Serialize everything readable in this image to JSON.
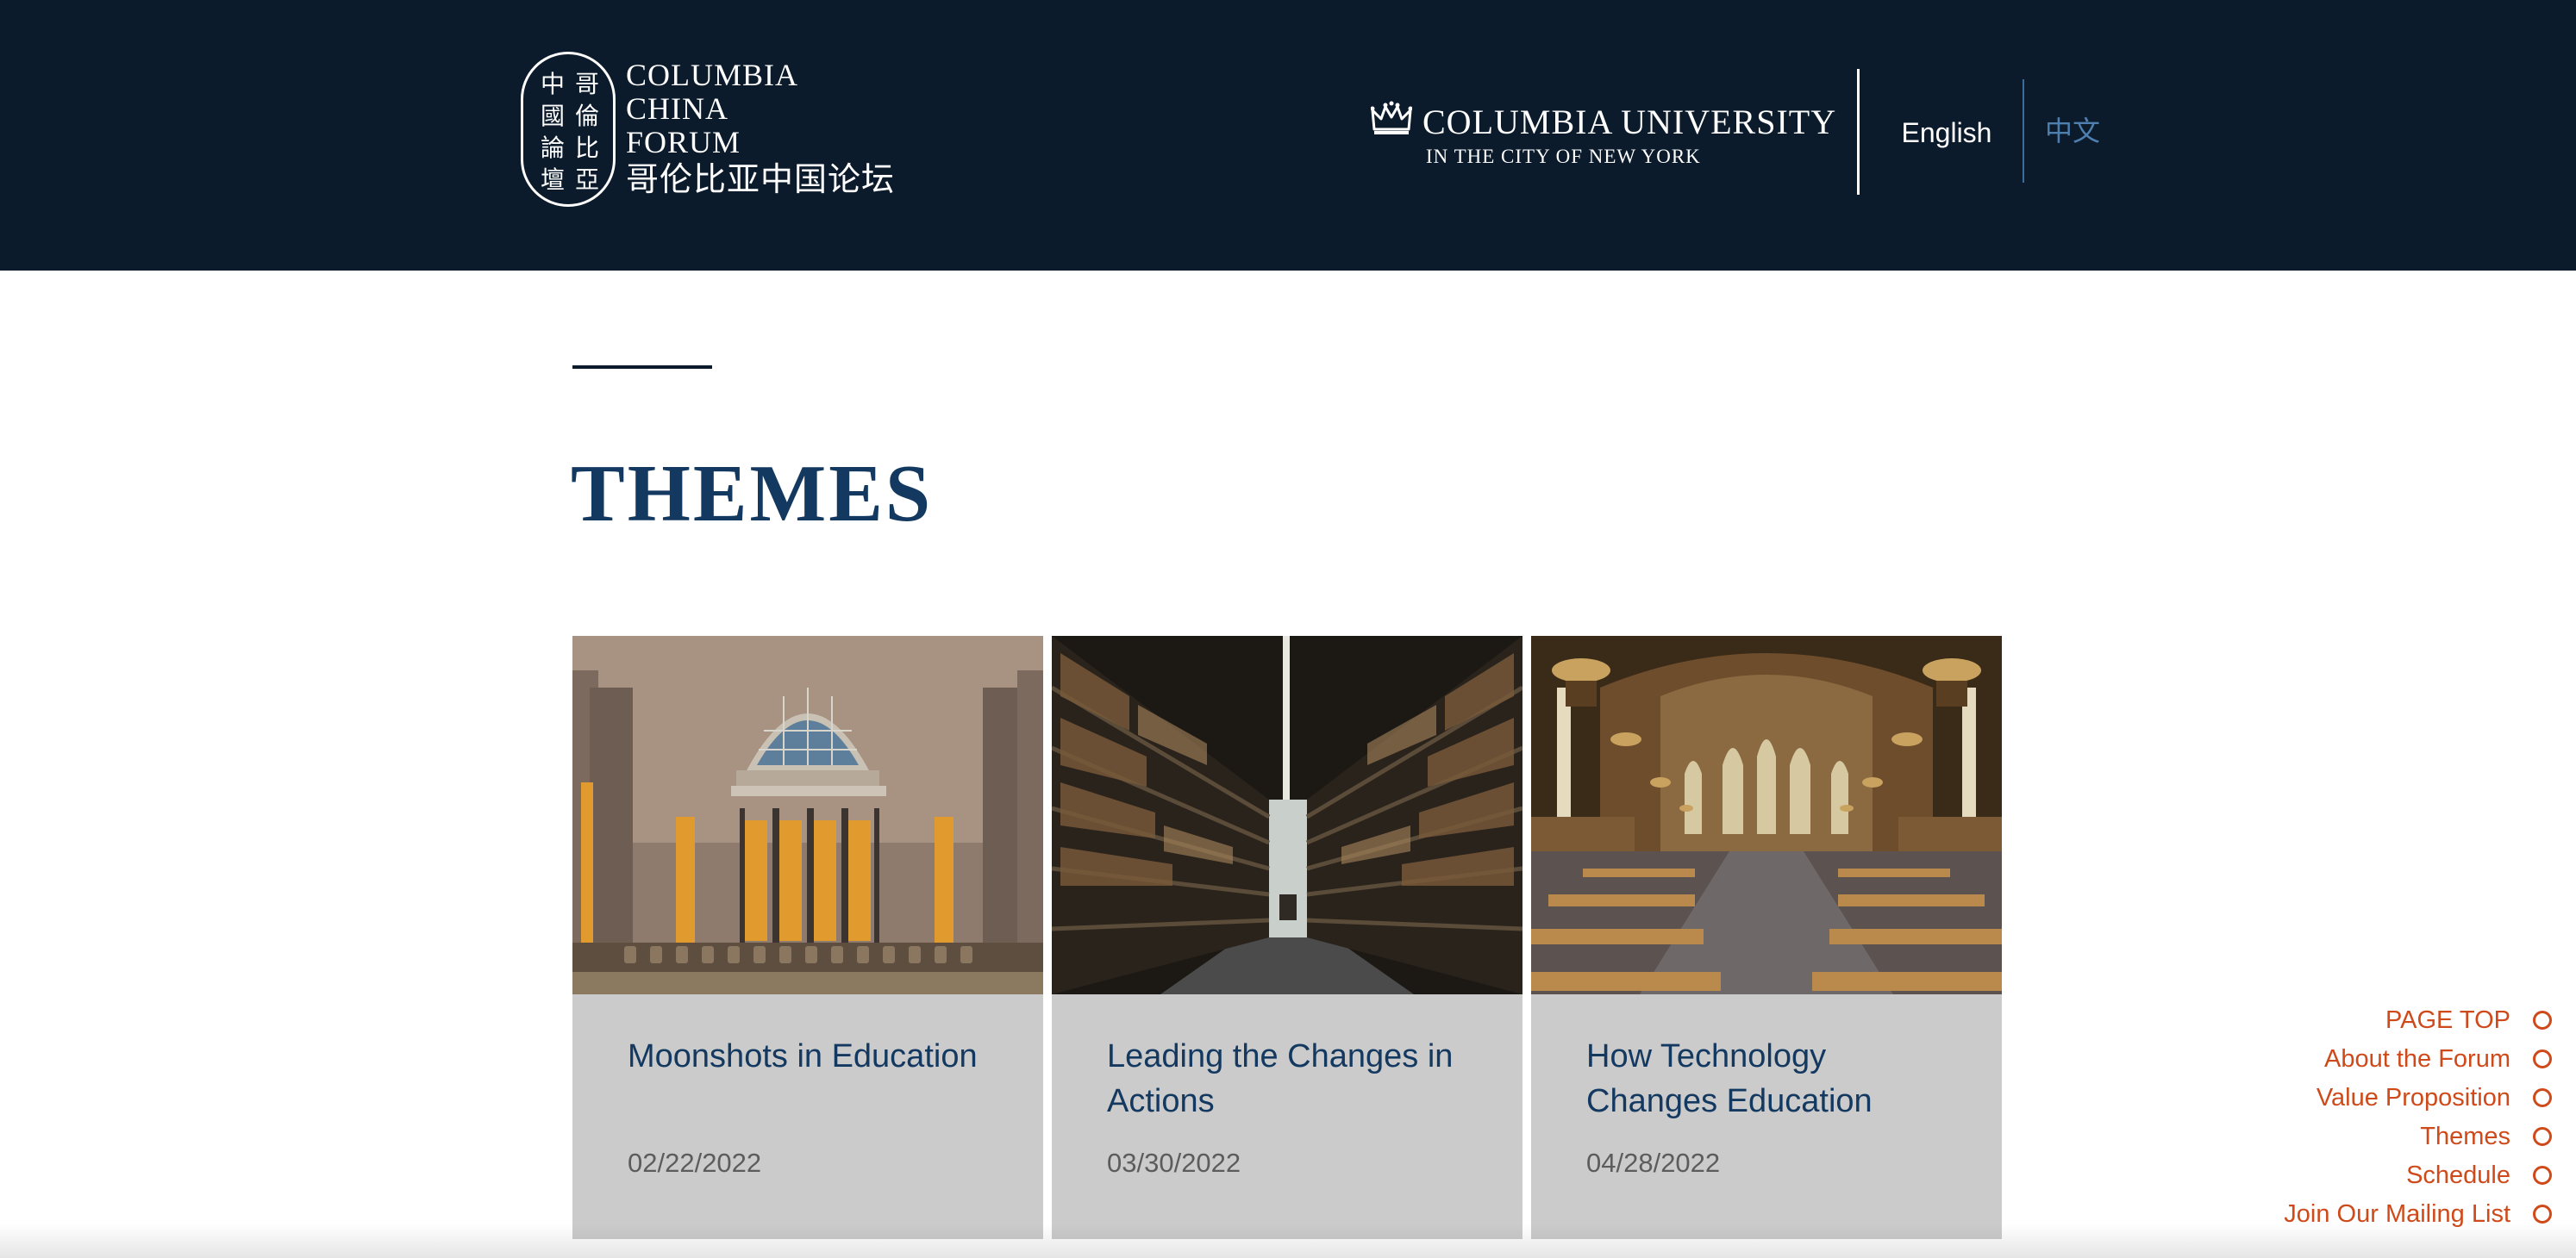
{
  "header": {
    "forum_logo": {
      "seal_chars": [
        "哥",
        "倫",
        "比",
        "亞",
        "中",
        "國",
        "論",
        "壇"
      ],
      "name_lines": [
        "COLUMBIA",
        "CHINA",
        "FORUM"
      ],
      "name_cn": "哥伦比亚中国论坛"
    },
    "university_logo": {
      "name": "COLUMBIA UNIVERSITY",
      "subtitle": "IN THE CITY OF NEW YORK",
      "icon": "crown-icon"
    },
    "language": {
      "english_label": "English",
      "chinese_label": "中文",
      "selected": "English"
    }
  },
  "section": {
    "title": "THEMES"
  },
  "themes": [
    {
      "title": "Moonshots in Education",
      "date": "02/22/2022",
      "image": "library-hall-photo"
    },
    {
      "title": "Leading the Changes in Actions",
      "date": "03/30/2022",
      "image": "library-stacks-photo"
    },
    {
      "title": "How Technology Changes Education",
      "date": "04/28/2022",
      "image": "reading-room-photo"
    }
  ],
  "side_nav": {
    "items": [
      {
        "label": "PAGE TOP"
      },
      {
        "label": "About the Forum"
      },
      {
        "label": "Value Proposition"
      },
      {
        "label": "Themes"
      },
      {
        "label": "Schedule"
      },
      {
        "label": "Join Our Mailing List"
      }
    ],
    "indicator_icon": "circle-icon"
  },
  "colors": {
    "header_bg": "#0b1b2c",
    "title_blue": "#143961",
    "card_bg": "#cbcbcb",
    "nav_orange": "#cf4a1a",
    "link_blue": "#4f7fae"
  }
}
